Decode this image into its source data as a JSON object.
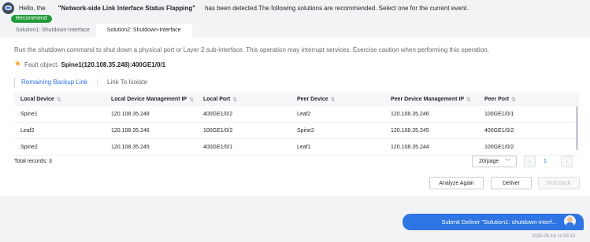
{
  "header": {
    "greeting": "Hello, the",
    "issue": "\"Network-side Link Interface Status Flapping\"",
    "message": "has been detected.The following solutions are recommended. Select one for the current event."
  },
  "recommend_badge": "Recommend",
  "solution_tabs": [
    {
      "label": "Solution1: Shutdown-Interface",
      "active": false
    },
    {
      "label": "Solution2: Shutdown-Interface",
      "active": true
    }
  ],
  "description": "Run the shutdown command to shut down a physical port or Layer 2 sub-interface. This operation may interrupt services. Exercise caution when performing this operation.",
  "fault": {
    "label": "Fault object:",
    "value": "Spine1(120.108.35.248):400GE1/0/1",
    "icon": "star-icon"
  },
  "subtabs": [
    {
      "label": "Remaining Backup Link",
      "active": true
    },
    {
      "label": "Link To Isolate",
      "active": false
    }
  ],
  "table": {
    "columns": [
      "Local Device",
      "Local Device Management IP",
      "Local Port",
      "Peer Device",
      "Peer Device Management IP",
      "Peer Port"
    ],
    "rows": [
      [
        "Spine1",
        "120.108.35.248",
        "400GE1/0/2",
        "Leaf2",
        "120.108.35.246",
        "100GE1/0/1"
      ],
      [
        "Leaf2",
        "120.108.35.246",
        "100GE1/0/2",
        "Spine2",
        "120.108.35.245",
        "400GE1/0/2"
      ],
      [
        "Spine2",
        "120.108.35.245",
        "400GE1/0/1",
        "Leaf1",
        "120.108.35.244",
        "100GE1/0/2"
      ]
    ]
  },
  "pagination": {
    "total": "Total records: 3",
    "page_size": "20/page",
    "current_page": "1",
    "prev_icon": "chevron-left-icon",
    "next_icon": "chevron-right-icon"
  },
  "actions": {
    "analyze": "Analyze Again",
    "deliver": "Deliver",
    "rollback": "Roll Back"
  },
  "chat": {
    "message": "Submit Deliver \"Solution1: shutdown-interf...",
    "timestamp": "2025-05-16 11:55:10"
  },
  "colors": {
    "accent": "#2f74e3",
    "recommend": "#1f9a3a",
    "star": "#f5a623"
  }
}
